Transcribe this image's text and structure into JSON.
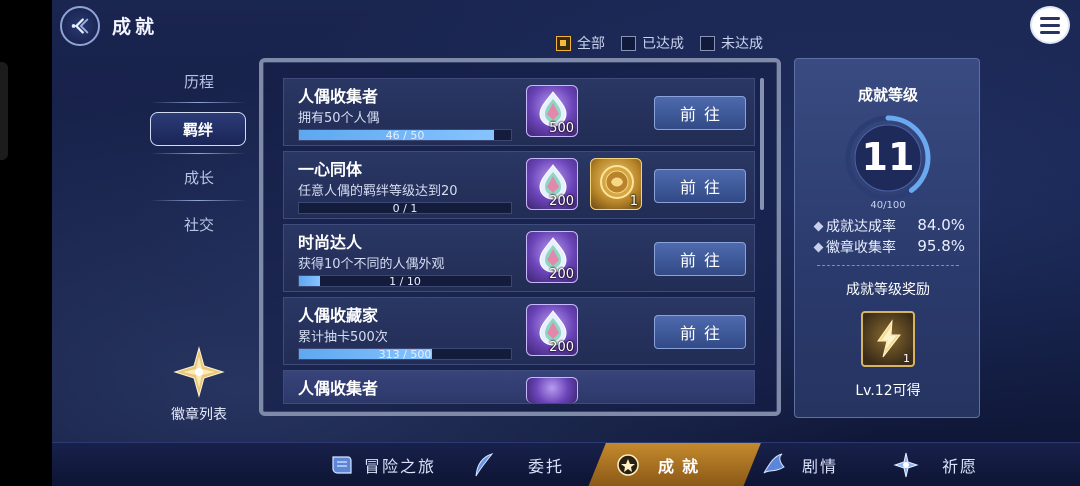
{
  "header": {
    "title": "成就",
    "back_icon": "back-arrow-icon",
    "menu_icon": "hamburger-menu-icon"
  },
  "filters": [
    {
      "label": "全部",
      "checked": true
    },
    {
      "label": "已达成",
      "checked": false
    },
    {
      "label": "未达成",
      "checked": false
    }
  ],
  "categories": [
    {
      "label": "历程",
      "active": false
    },
    {
      "label": "羁绊",
      "active": true
    },
    {
      "label": "成长",
      "active": false
    },
    {
      "label": "社交",
      "active": false
    }
  ],
  "badge_list": {
    "label": "徽章列表",
    "icon": "star-badge-icon"
  },
  "achievements": [
    {
      "title": "人偶收集者",
      "desc": "拥有50个人偶",
      "progress_text": "46 / 50",
      "progress": 0.92,
      "rewards": [
        {
          "type": "crystal",
          "qty": "500"
        }
      ],
      "action": "前往"
    },
    {
      "title": "一心同体",
      "desc": "任意人偶的羁绊等级达到20",
      "progress_text": "0 / 1",
      "progress": 0,
      "rewards": [
        {
          "type": "crystal",
          "qty": "200"
        },
        {
          "type": "gold-coin",
          "qty": "1"
        }
      ],
      "action": "前往"
    },
    {
      "title": "时尚达人",
      "desc": "获得10个不同的人偶外观",
      "progress_text": "1 / 10",
      "progress": 0.1,
      "rewards": [
        {
          "type": "crystal",
          "qty": "200"
        }
      ],
      "action": "前往"
    },
    {
      "title": "人偶收藏家",
      "desc": "累计抽卡500次",
      "progress_text": "313 / 500",
      "progress": 0.626,
      "rewards": [
        {
          "type": "crystal",
          "qty": "200"
        }
      ],
      "action": "前往"
    },
    {
      "title": "人偶收集者"
    }
  ],
  "rank": {
    "title": "成就等级",
    "level": "11",
    "exp_text": "40/100",
    "exp_fraction": 0.4,
    "completion_label": "成就达成率",
    "completion_value": "84.0%",
    "badge_label": "徽章收集率",
    "badge_value": "95.8%",
    "reward_title": "成就等级奖励",
    "reward_qty": "1",
    "reward_icon": "lightning-crystal-icon",
    "reward_unlock": "Lv.12可得"
  },
  "nav": [
    {
      "label": "冒险之旅",
      "icon": "scroll-map-icon",
      "active": false
    },
    {
      "label": "委托",
      "icon": "feather-icon",
      "active": false
    },
    {
      "label": "成就",
      "icon": "medal-icon",
      "active": true
    },
    {
      "label": "剧情",
      "icon": "wave-book-icon",
      "active": false
    },
    {
      "label": "祈愿",
      "icon": "sparkle-star-icon",
      "active": false
    }
  ],
  "colors": {
    "accent_gold": "#f5b93e",
    "progress_blue": "#6fb4f5",
    "panel_bg": "#222d55"
  }
}
